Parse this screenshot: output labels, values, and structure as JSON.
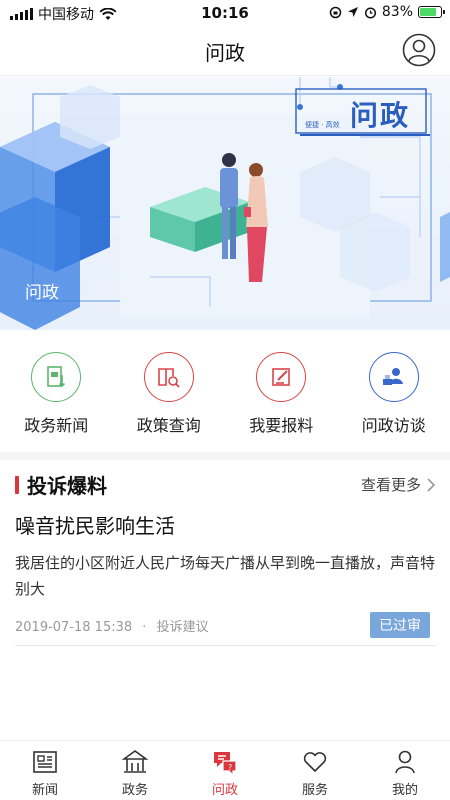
{
  "status_bar": {
    "carrier": "中国移动",
    "time": "10:16",
    "battery_percent": "83%",
    "battery_level": 0.83
  },
  "header": {
    "title": "问政"
  },
  "banner": {
    "caption": "问政",
    "brand": "问政",
    "slogan": "便捷 · 高效"
  },
  "quick_menu": [
    {
      "label": "政务新闻",
      "icon": "news-document-icon",
      "color": "#5bb56d"
    },
    {
      "label": "政策查询",
      "icon": "policy-search-icon",
      "color": "#d9454a"
    },
    {
      "label": "我要报料",
      "icon": "report-edit-icon",
      "color": "#d9454a"
    },
    {
      "label": "问政访谈",
      "icon": "interview-person-icon",
      "color": "#3a68c9"
    }
  ],
  "section": {
    "title": "投诉爆料",
    "more_label": "查看更多"
  },
  "news": {
    "title": "噪音扰民影响生活",
    "body": "我居住的小区附近人民广场每天广播从早到晚一直播放，声音特别大",
    "date": "2019-07-18 15:38",
    "separator": "·",
    "category": "投诉建议",
    "status": "已过审"
  },
  "tabs": [
    {
      "label": "新闻",
      "icon": "newspaper-icon"
    },
    {
      "label": "政务",
      "icon": "government-building-icon"
    },
    {
      "label": "问政",
      "icon": "question-chat-icon",
      "active": true
    },
    {
      "label": "服务",
      "icon": "heart-icon"
    },
    {
      "label": "我的",
      "icon": "person-icon"
    }
  ],
  "colors": {
    "accent_red": "#d9363e",
    "badge_blue": "#7aa7db",
    "brand_blue": "#2a5fc0"
  }
}
